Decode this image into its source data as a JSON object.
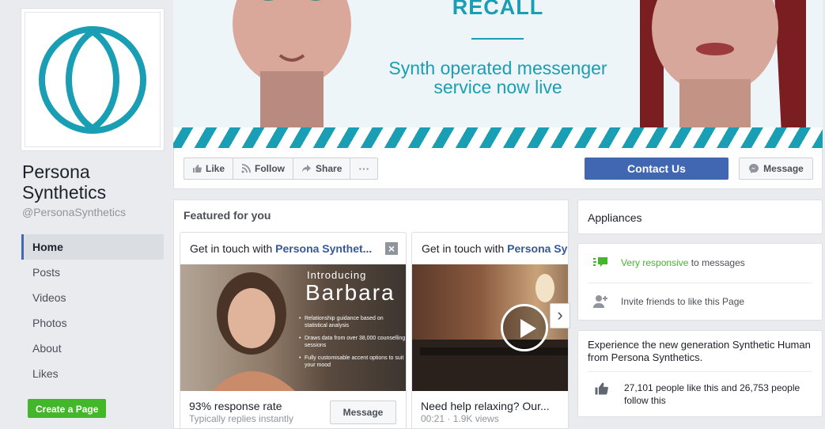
{
  "page": {
    "name": "Persona Synthetics",
    "handle": "@PersonaSynthetics"
  },
  "nav": {
    "items": [
      {
        "label": "Home",
        "active": true
      },
      {
        "label": "Posts"
      },
      {
        "label": "Videos"
      },
      {
        "label": "Photos"
      },
      {
        "label": "About"
      },
      {
        "label": "Likes"
      }
    ],
    "create_page": "Create a Page"
  },
  "cover": {
    "headline": "RECALL",
    "tagline_line1": "Synth operated messenger",
    "tagline_line2": "service now live",
    "accent": "#1a9eb3"
  },
  "actions": {
    "like": "Like",
    "follow": "Follow",
    "share": "Share",
    "more": "···",
    "contact": "Contact Us",
    "message": "Message"
  },
  "featured": {
    "title": "Featured for you",
    "cards": [
      {
        "head_prefix": "Get in touch with ",
        "head_name": "Persona Synthet...",
        "intro_small": "Introducing",
        "intro_big": "Barbara",
        "bullets": [
          "Relationship guidance based on statistical analysis",
          "Draws data from over 38,000 counselling sessions",
          "Fully customisable accent options to suit your mood"
        ],
        "foot_title": "93% response rate",
        "foot_sub": "Typically replies instantly",
        "button": "Message"
      },
      {
        "head_prefix": "Get in touch with ",
        "head_name": "Persona Synthetics",
        "foot_title": "Need help relaxing? Our...",
        "foot_sub": "00:21 · 1.9K views"
      }
    ]
  },
  "sidebar": {
    "category": "Appliances",
    "responsive_strong": "Very responsive",
    "responsive_rest": " to messages",
    "invite": "Invite friends to like this Page",
    "about": "Experience the new generation Synthetic Human from Persona Synthetics.",
    "likes": "27,101 people like this and 26,753 people follow this"
  },
  "colors": {
    "brand_blue": "#4267b2",
    "green": "#42b72a"
  }
}
